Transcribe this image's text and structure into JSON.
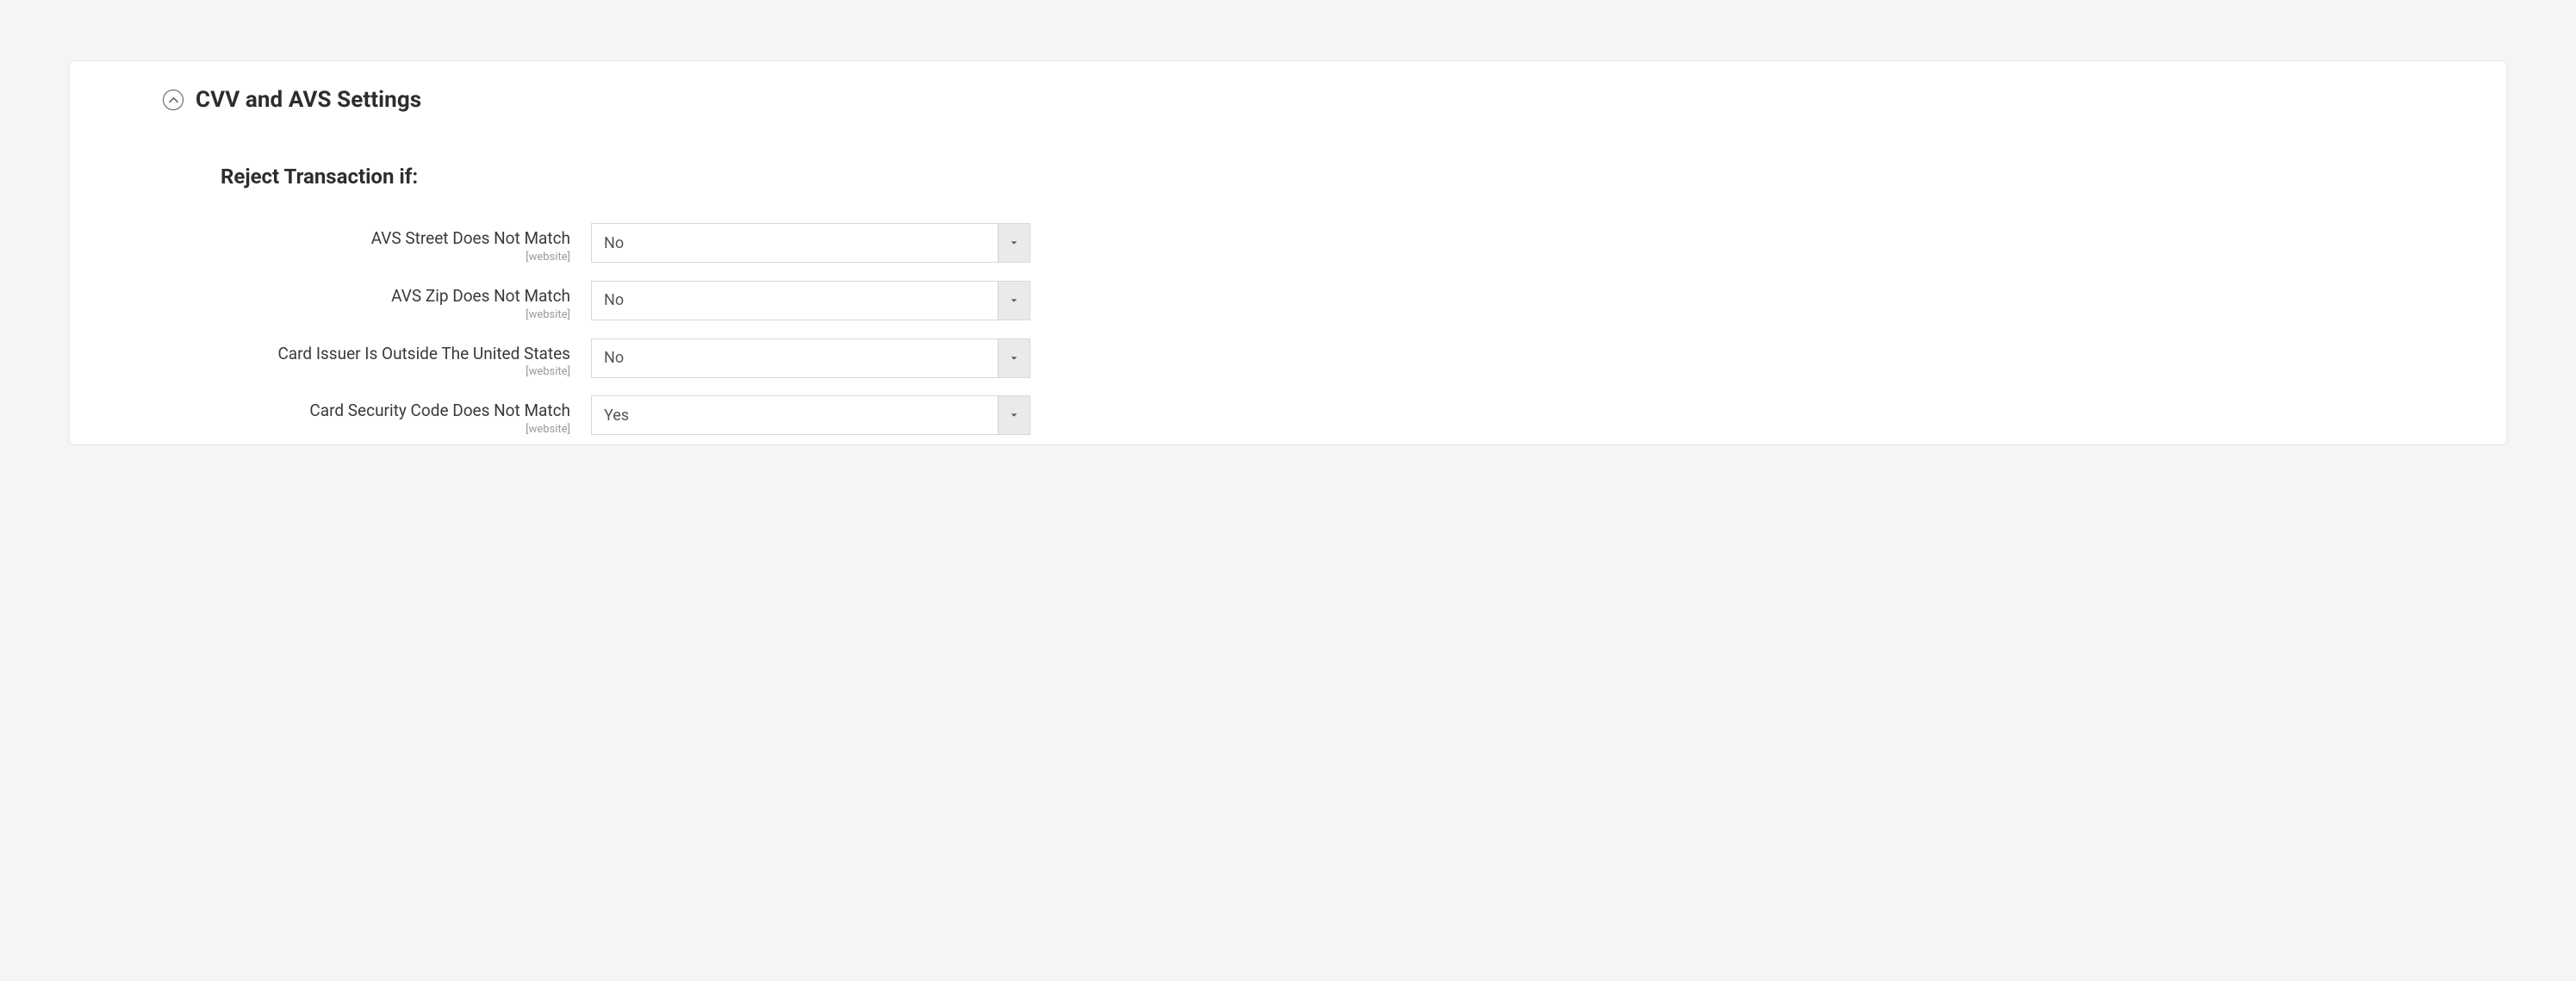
{
  "section": {
    "title": "CVV and AVS Settings",
    "subsection_title": "Reject Transaction if:"
  },
  "fields": [
    {
      "label": "AVS Street Does Not Match",
      "scope": "[website]",
      "value": "No"
    },
    {
      "label": "AVS Zip Does Not Match",
      "scope": "[website]",
      "value": "No"
    },
    {
      "label": "Card Issuer Is Outside The United States",
      "scope": "[website]",
      "value": "No"
    },
    {
      "label": "Card Security Code Does Not Match",
      "scope": "[website]",
      "value": "Yes"
    }
  ]
}
